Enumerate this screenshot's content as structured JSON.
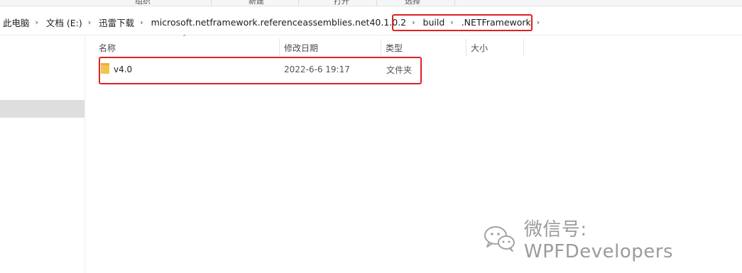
{
  "ribbon": {
    "labels": [
      "组织",
      "新建",
      "打开",
      "选择"
    ]
  },
  "breadcrumb": {
    "items": [
      "此电脑",
      "文档 (E:)",
      "迅雷下载",
      "microsoft.netframework.referenceassemblies.net40.1.0.2",
      "build",
      ".NETFramework"
    ]
  },
  "columns": {
    "name": "名称",
    "modified": "修改日期",
    "type": "类型",
    "size": "大小"
  },
  "rows": [
    {
      "name": "v4.0",
      "modified": "2022-6-6 19:17",
      "type": "文件夹",
      "size": ""
    }
  ],
  "colors": {
    "highlight": "#e02020",
    "folder": "#f3c34f",
    "selected_nav": "#dedede"
  },
  "watermark": {
    "text": "微信号: WPFDevelopers",
    "icon": "wechat-icon"
  }
}
